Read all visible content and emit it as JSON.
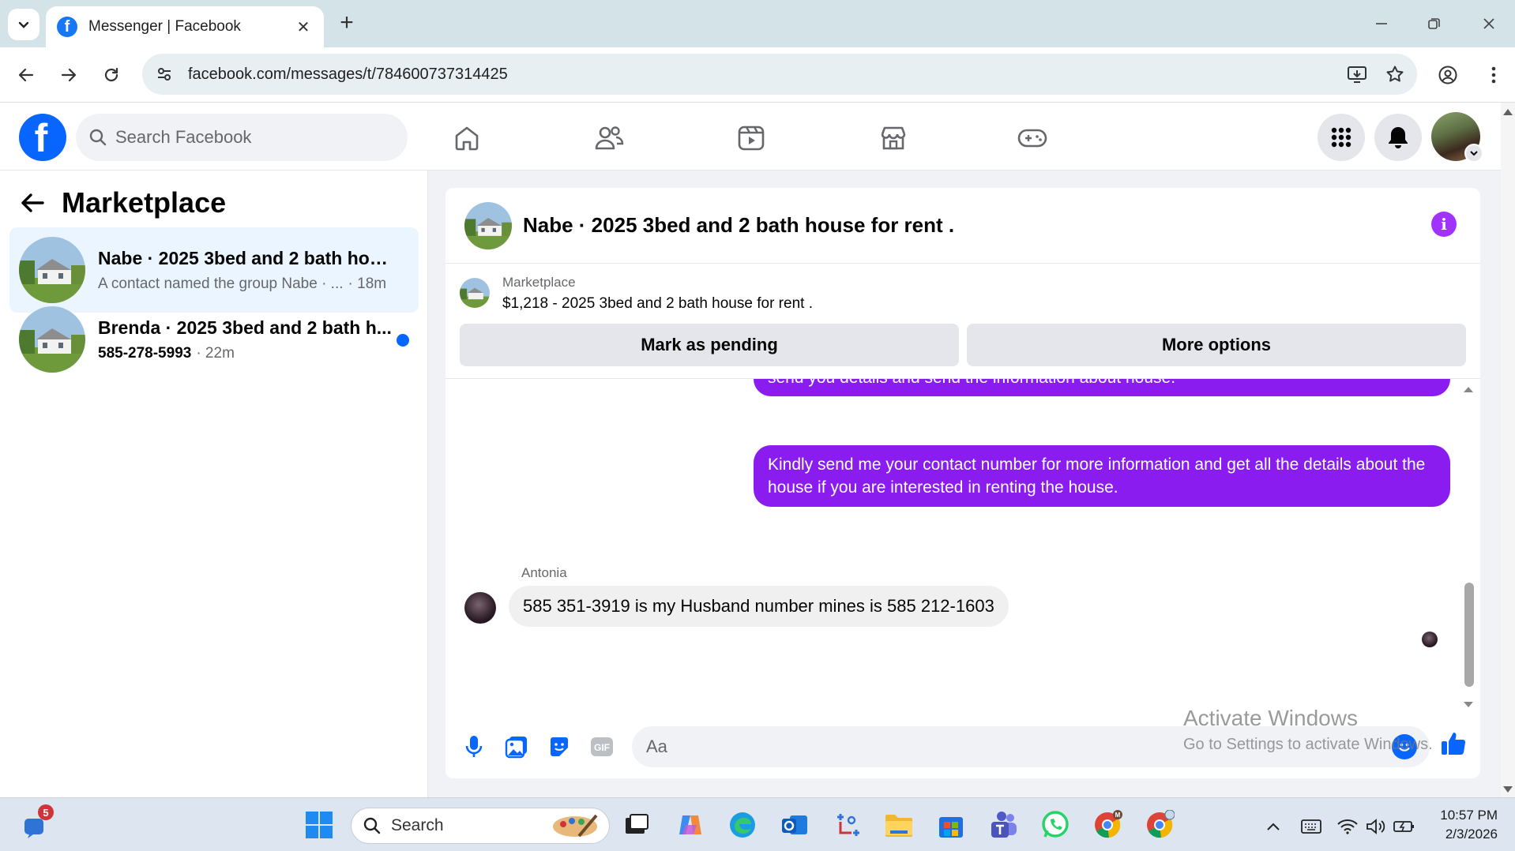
{
  "browser": {
    "tab_title": "Messenger | Facebook",
    "url": "facebook.com/messages/t/784600737314425"
  },
  "fb": {
    "search_placeholder": "Search Facebook"
  },
  "left_panel": {
    "title": "Marketplace",
    "conversations": [
      {
        "name": "Nabe · 2025 3bed and 2 bath hous...",
        "preview": "A contact named the group Nabe · ...",
        "time": "· 18m",
        "active": true
      },
      {
        "name": "Brenda · 2025 3bed and 2 bath h...",
        "preview": "585-278-5993",
        "time": "· 22m",
        "unread": true
      }
    ]
  },
  "chat": {
    "title": "Nabe · 2025 3bed and 2 bath house for rent .",
    "listing": {
      "label": "Marketplace",
      "price_title": "$1,218 - 2025 3bed and 2 bath house for rent ."
    },
    "buttons": {
      "pending": "Mark as pending",
      "more": "More options"
    },
    "messages": [
      {
        "direction": "out",
        "text": "send you details and send the information about house."
      },
      {
        "direction": "out",
        "text": "Kindly send me your contact number for more information and get all the details about the house if you are interested in renting the house."
      },
      {
        "direction": "in",
        "sender": "Antonia",
        "text": "585 351-3919 is my Husband number mines is 585 212-1603"
      }
    ],
    "composer_placeholder": "Aa"
  },
  "watermark": {
    "line1": "Activate Windows",
    "line2": "Go to Settings to activate Windows."
  },
  "taskbar": {
    "search": "Search",
    "notification_count": "5",
    "time": "10:57 PM",
    "date": "2/3/2026"
  },
  "colors": {
    "fb_blue": "#0866ff",
    "bubble_purple": "#8a1cf0",
    "info_purple": "#a033ff"
  }
}
